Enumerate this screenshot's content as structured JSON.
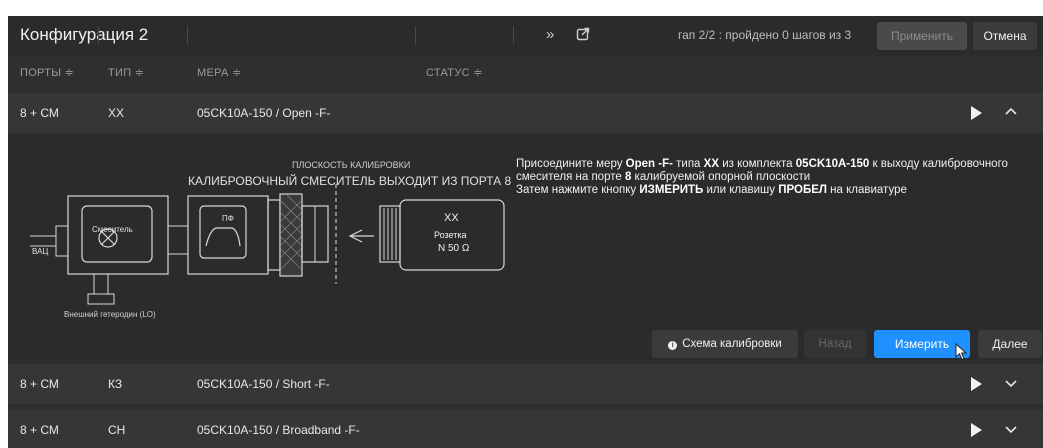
{
  "header": {
    "title": "Конфигурация 2",
    "progress": "гап 2/2 : пройдено 0 шагов из 3",
    "apply_label": "Применить",
    "cancel_label": "Отмена",
    "icons": [
      "double-chevron-right-icon",
      "external-link-icon"
    ]
  },
  "columns": [
    {
      "label": "ПОРТЫ ≑"
    },
    {
      "label": "ТИП ≑"
    },
    {
      "label": "МЕРА ≑"
    },
    {
      "label": "СТАТУС ≑"
    }
  ],
  "rows": [
    {
      "ports": "8 + СМ",
      "type": "ХХ",
      "measure": "05CK10A-150 / Open -F-",
      "expanded": true
    },
    {
      "ports": "8 + СМ",
      "type": "КЗ",
      "measure": "05CK10A-150 / Short -F-",
      "expanded": false
    },
    {
      "ports": "8 + СМ",
      "type": "СН",
      "measure": "05CK10A-150 / Broadband -F-",
      "expanded": false
    }
  ],
  "diagram": {
    "plane_label": "ПЛОСКОСТЬ КАЛИБРОВКИ",
    "mixer_label": "КАЛИБРОВОЧНЫЙ СМЕСИТЕЛЬ ВЫХОДИТ ИЗ ПОРТА 8",
    "vac_label": "ВАЦ",
    "mixer_box_label": "Смеситель",
    "pf_label": "ПФ",
    "lo_label": "Внешний гетеродин (LO)",
    "std_type": "ХХ",
    "std_connector": "Розетка",
    "std_impedance": "N 50 Ω"
  },
  "instructions": {
    "line1_a": "Присоедините меру ",
    "line1_b": "Open -F-",
    "line1_c": "  типа ",
    "line1_d": "ХХ",
    "line1_e": " из комплекта ",
    "line1_f": "05CK10A-150",
    "line1_g": " к выходу калибровочного",
    "line2_a": "смесителя на порте ",
    "line2_b": "8",
    "line2_c": " калибруемой опорной плоскости",
    "line3_a": "Затем нажмите кнопку ",
    "line3_b": "ИЗМЕРИТЬ",
    "line3_c": " или клавишу ",
    "line3_d": "ПРОБЕЛ",
    "line3_e": " на клавиатуре"
  },
  "actions": {
    "scheme_label": "Схема калибровки",
    "back_label": "Назад",
    "measure_label": "Измерить",
    "next_label": "Далее"
  },
  "colors": {
    "accent": "#1e90ff",
    "panel_bg": "#2f2f2f",
    "row_bg": "#363636"
  }
}
